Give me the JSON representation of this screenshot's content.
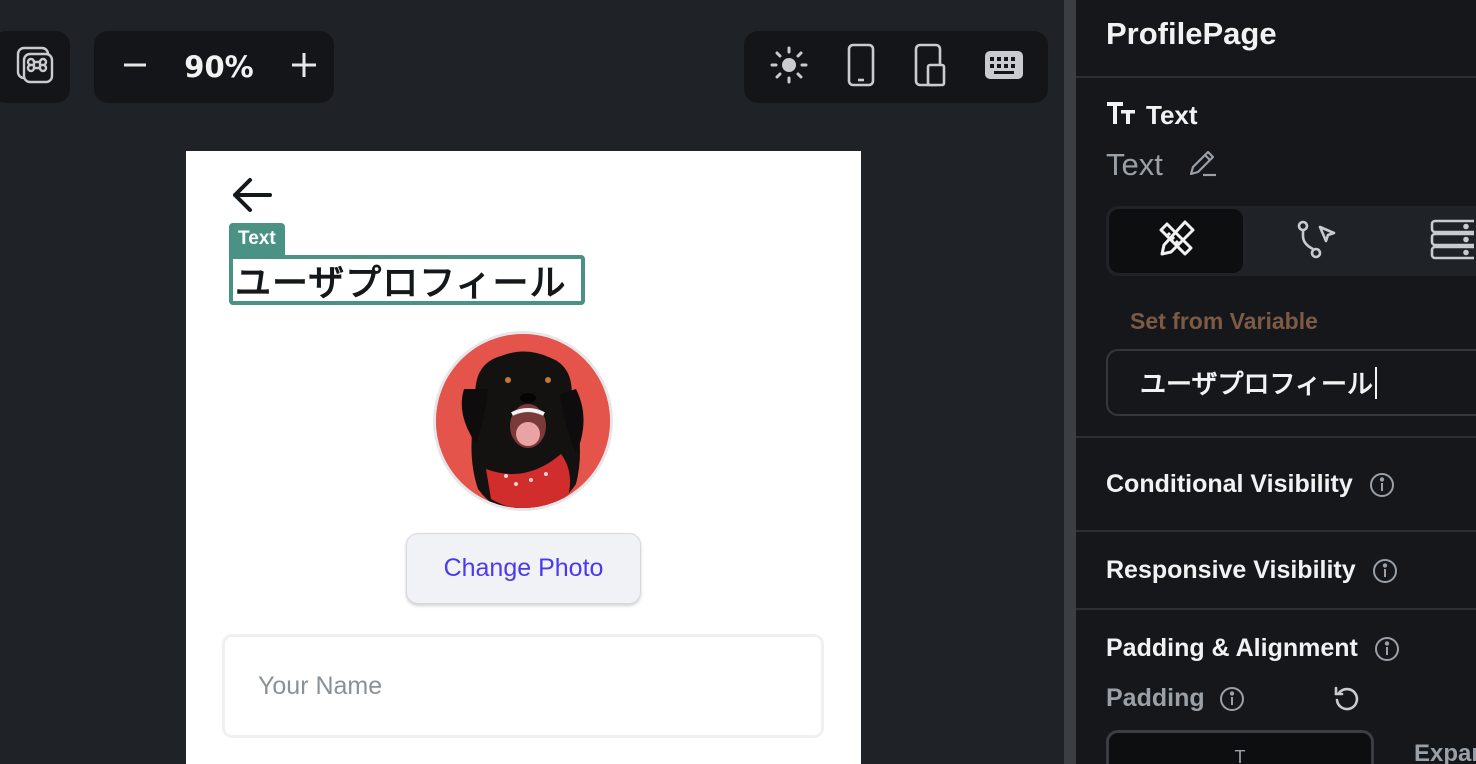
{
  "toolbar": {
    "zoom_value": "90%",
    "icons": [
      "command-icon",
      "minus-icon",
      "plus-icon",
      "sun-icon",
      "phone-icon",
      "tablet-icon",
      "keyboard-icon"
    ]
  },
  "preview": {
    "selection_tag": "Text",
    "title_text": "ユーザプロフィール",
    "change_photo_label": "Change Photo",
    "name_placeholder": "Your Name",
    "colors": {
      "accent": "#4b39ef",
      "selection": "#4a9283"
    }
  },
  "panel": {
    "page_title": "ProfilePage",
    "section_title": "Text",
    "widget_name": "Text",
    "set_from_variable": "Set from Variable",
    "text_value": "ユーザプロフィール",
    "conditional_visibility": "Conditional Visibility",
    "responsive_visibility": "Responsive Visibility",
    "padding_alignment": "Padding & Alignment",
    "padding_label": "Padding",
    "padding_top_value": "T",
    "expand_label": "Expan"
  }
}
